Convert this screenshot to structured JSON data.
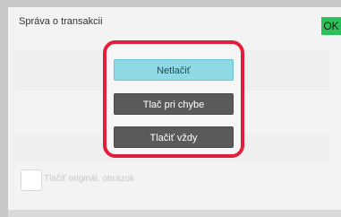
{
  "header": {
    "title": "Správa o transakcii",
    "ok_label": "OK"
  },
  "options": [
    {
      "label": "Netlačiť",
      "selected": true
    },
    {
      "label": "Tlač pri chybe",
      "selected": false
    },
    {
      "label": "Tlačiť vždy",
      "selected": false
    }
  ],
  "checkbox": {
    "label": "Tlačiť originál. obrázok",
    "checked": false,
    "enabled": false
  },
  "colors": {
    "highlight": "#e0203a",
    "selected_option": "#8fd9e5",
    "option": "#5a5a5a",
    "ok": "#2cc15a"
  }
}
